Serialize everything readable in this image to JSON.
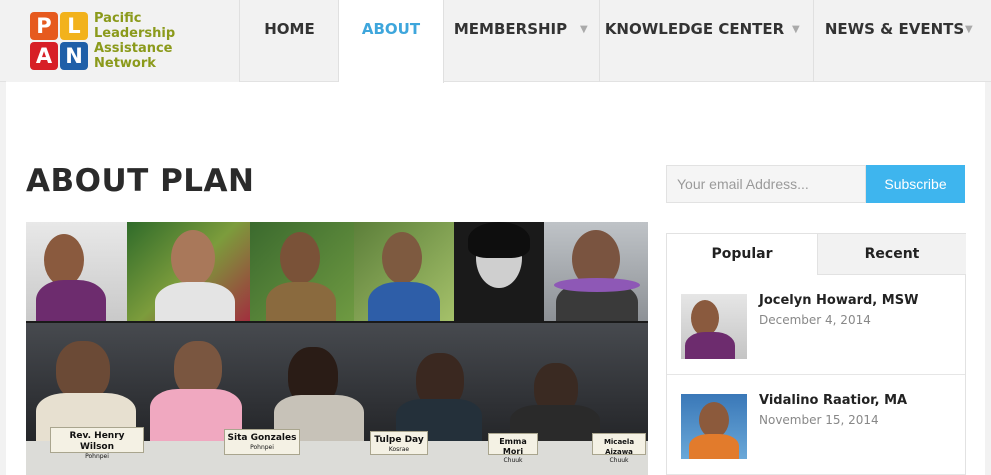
{
  "logo": {
    "letters": [
      "P",
      "L",
      "A",
      "N"
    ],
    "text_lines": [
      "Pacific",
      "Leadership",
      "Assistance",
      "Network"
    ]
  },
  "nav": {
    "items": [
      {
        "label": "HOME",
        "has_dropdown": false,
        "active": false
      },
      {
        "label": "ABOUT",
        "has_dropdown": false,
        "active": true
      },
      {
        "label": "MEMBERSHIP",
        "has_dropdown": true,
        "active": false
      },
      {
        "label": "KNOWLEDGE CENTER",
        "has_dropdown": true,
        "active": false
      },
      {
        "label": "NEWS & EVENTS",
        "has_dropdown": true,
        "active": false
      }
    ],
    "caret": "▼"
  },
  "page": {
    "title": "ABOUT PLAN"
  },
  "collage": {
    "nameplates": [
      {
        "name": "Rev. Henry Wilson",
        "location": "Pohnpei"
      },
      {
        "name": "Sita Gonzales",
        "location": "Pohnpei"
      },
      {
        "name": "Tulpe Day",
        "location": "Kosrae"
      },
      {
        "name": "Emma Mori",
        "location": "Chuuk"
      },
      {
        "name": "Micaela Aizawa",
        "location": "Chuuk"
      }
    ]
  },
  "subscribe": {
    "placeholder": "Your email Address...",
    "button_label": "Subscribe"
  },
  "tabs": {
    "popular_label": "Popular",
    "recent_label": "Recent",
    "active": "Popular"
  },
  "posts": [
    {
      "title": "Jocelyn Howard, MSW",
      "date": "December 4, 2014"
    },
    {
      "title": "Vidalino Raatior, MA",
      "date": "November 15, 2014"
    }
  ],
  "colors": {
    "accent": "#3ea6dc",
    "subscribe": "#3eb5ee",
    "logo_text": "#8b9a1b",
    "logo_p": "#e65a1e",
    "logo_l": "#f2b21c",
    "logo_a": "#d71f26",
    "logo_n": "#1f5fa8"
  }
}
